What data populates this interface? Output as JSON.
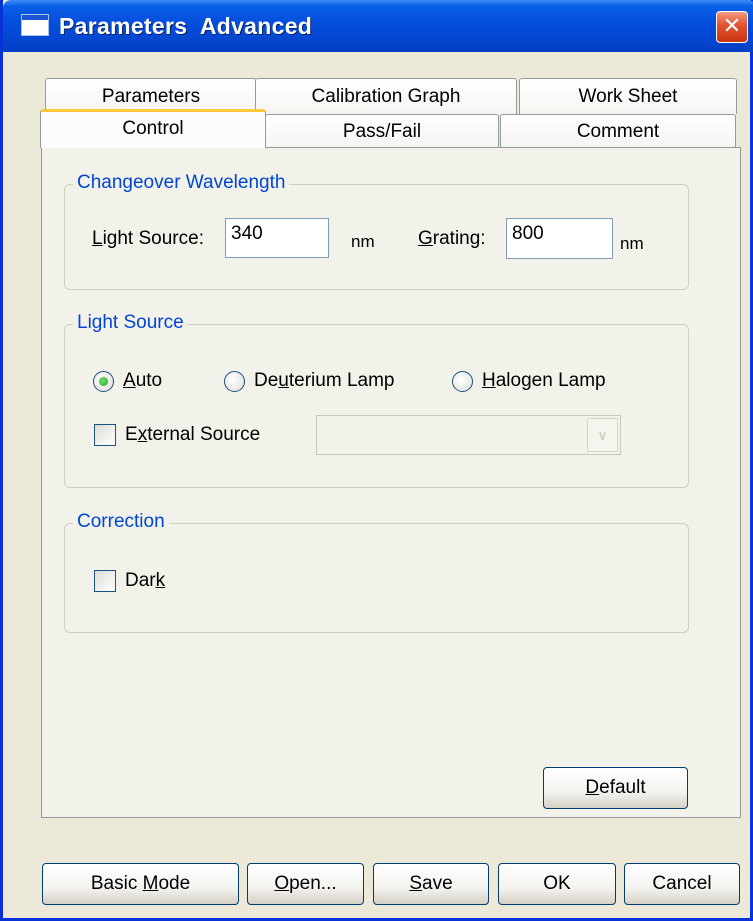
{
  "window": {
    "title": "Parameters  Advanced",
    "close_glyph": "✕"
  },
  "tabs": {
    "back_row": [
      "Parameters",
      "Calibration Graph",
      "Work Sheet"
    ],
    "front_row": [
      "Control",
      "Pass/Fail",
      "Comment"
    ],
    "active": "Control"
  },
  "changeover": {
    "title": "Changeover Wavelength",
    "light_source_label_u": "L",
    "light_source_label_rest": "ight Source:",
    "light_source_value": "340",
    "light_source_unit": "nm",
    "grating_label_u": "G",
    "grating_label_rest": "rating:",
    "grating_value": "800",
    "grating_unit": "nm"
  },
  "light_source": {
    "title": "Light Source",
    "auto_u": "A",
    "auto_rest": "uto",
    "deut_pre": "De",
    "deut_u": "u",
    "deut_rest": "terium Lamp",
    "halo_u": "H",
    "halo_rest": "alogen Lamp",
    "selected": "Auto",
    "external_pre": "E",
    "external_u": "x",
    "external_rest": "ternal Source",
    "external_checked": false,
    "external_value": ""
  },
  "correction": {
    "title": "Correction",
    "dark_pre": "Dar",
    "dark_u": "k",
    "dark_checked": false
  },
  "buttons": {
    "default_u": "D",
    "default_rest": "efault",
    "basic_pre": "Basic ",
    "basic_u": "M",
    "basic_rest": "ode",
    "open_u": "O",
    "open_rest": "pen...",
    "save_u": "S",
    "save_rest": "ave",
    "ok": "OK",
    "cancel": "Cancel"
  },
  "colors": {
    "titlebar": "#0550de",
    "group_title": "#0046d5",
    "tab_highlight": "#ffc83c",
    "close_button": "#e2522f"
  }
}
